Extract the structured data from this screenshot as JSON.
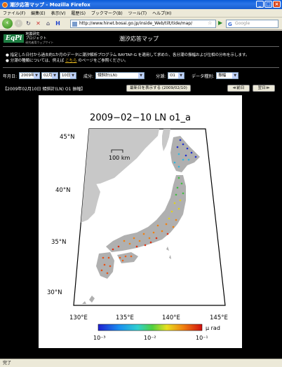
{
  "window": {
    "title": "潮汐応答マップ - Mozilla Firefox"
  },
  "menu": [
    "ファイル(F)",
    "編集(E)",
    "表示(V)",
    "履歴(S)",
    "ブックマーク(B)",
    "ツール(T)",
    "ヘルプ(H)"
  ],
  "nav": {
    "url": "http://www.hinet.bosai.go.jp/inside_Web/tilt/tide/map/",
    "search_placeholder": "Google"
  },
  "page": {
    "logo_line1": "地震研究",
    "logo_line2": "プロジェクト",
    "logo_line3": "研究者用ウェブサイト",
    "logo_mark": "EqPi",
    "title": "潮汐応答マップ",
    "info1": "指定した日付から過去約1か月のデータに潮汐解析プログラム BAYTAP-G を適用して求めた、各分潮の振幅および位相の分布を示します。",
    "info2_pre": "分潮の種類については、例えば ",
    "info2_link": "こちら",
    "info2_post": " のページをご参照ください。"
  },
  "controls": {
    "ymd_label": "年月日:",
    "year": "2009年",
    "month": "02月",
    "day": "10日",
    "component_label": "成分:",
    "component": "傾斜計(LN)",
    "tide_label": "分潮:",
    "tide": "O1",
    "datatype_label": "データ種別:",
    "datatype": "振幅"
  },
  "daterow": {
    "caption": "【2009年02月10日 傾斜計(LN) O1 振幅】",
    "latest_button": "最新日を表示する (2009/02/10)",
    "prev_button": "≪前日",
    "next_button": "翌日≫"
  },
  "map": {
    "title": "2009−02−10  LN  o1_a",
    "lat_labels": [
      "45°N",
      "40°N",
      "35°N",
      "30°N"
    ],
    "lon_labels": [
      "130°E",
      "135°E",
      "140°E",
      "145°E"
    ],
    "scale_label": "100 km",
    "colorbar_unit": "μ rad",
    "colorbar_ticks": [
      "10⁻³",
      "10⁻²",
      "10⁻¹"
    ]
  },
  "status": {
    "text": "完了"
  }
}
